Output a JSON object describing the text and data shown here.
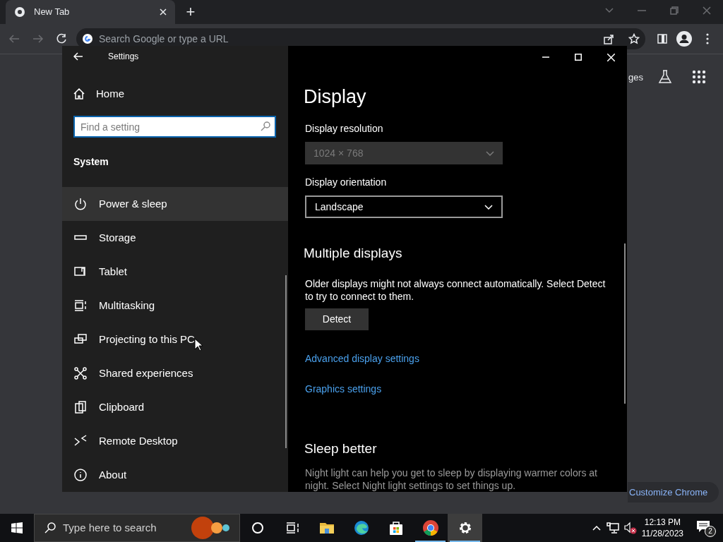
{
  "browser": {
    "tab": {
      "title": "New Tab",
      "selected": true
    },
    "new_tab": "+",
    "address_placeholder": "Search Google or type a URL",
    "page": {
      "partial_link": "ges",
      "customize": "Customize Chrome"
    }
  },
  "settings": {
    "title": "Settings",
    "home": "Home",
    "search_placeholder": "Find a setting",
    "section": "System",
    "nav": [
      {
        "label": "Power & sleep",
        "selected": true
      },
      {
        "label": "Storage",
        "selected": false
      },
      {
        "label": "Tablet",
        "selected": false
      },
      {
        "label": "Multitasking",
        "selected": false
      },
      {
        "label": "Projecting to this PC",
        "selected": false
      },
      {
        "label": "Shared experiences",
        "selected": false
      },
      {
        "label": "Clipboard",
        "selected": false
      },
      {
        "label": "Remote Desktop",
        "selected": false
      },
      {
        "label": "About",
        "selected": false
      }
    ],
    "content": {
      "heading": "Display",
      "resolution": {
        "label": "Display resolution",
        "value": "1024 × 768",
        "disabled": true
      },
      "orientation": {
        "label": "Display orientation",
        "value": "Landscape",
        "disabled": false
      },
      "multiple_heading": "Multiple displays",
      "multiple_text": "Older displays might not always connect automatically. Select Detect to try to connect to them.",
      "detect": "Detect",
      "links": [
        "Advanced display settings",
        "Graphics settings"
      ],
      "sleep_heading": "Sleep better",
      "sleep_text": "Night light can help you get to sleep by displaying warmer colors at night. Select Night light settings to set things up."
    }
  },
  "taskbar": {
    "search_placeholder": "Type here to search",
    "apps": [
      {
        "running": false,
        "selected": false
      },
      {
        "running": false,
        "selected": false
      },
      {
        "running": false,
        "selected": false
      },
      {
        "running": false,
        "selected": false
      },
      {
        "running": false,
        "selected": false
      },
      {
        "running": false,
        "selected": false
      },
      {
        "running": true,
        "selected": false
      },
      {
        "running": true,
        "selected": true
      }
    ],
    "time": "12:13 PM",
    "date": "11/28/2023",
    "notifications": "2"
  }
}
